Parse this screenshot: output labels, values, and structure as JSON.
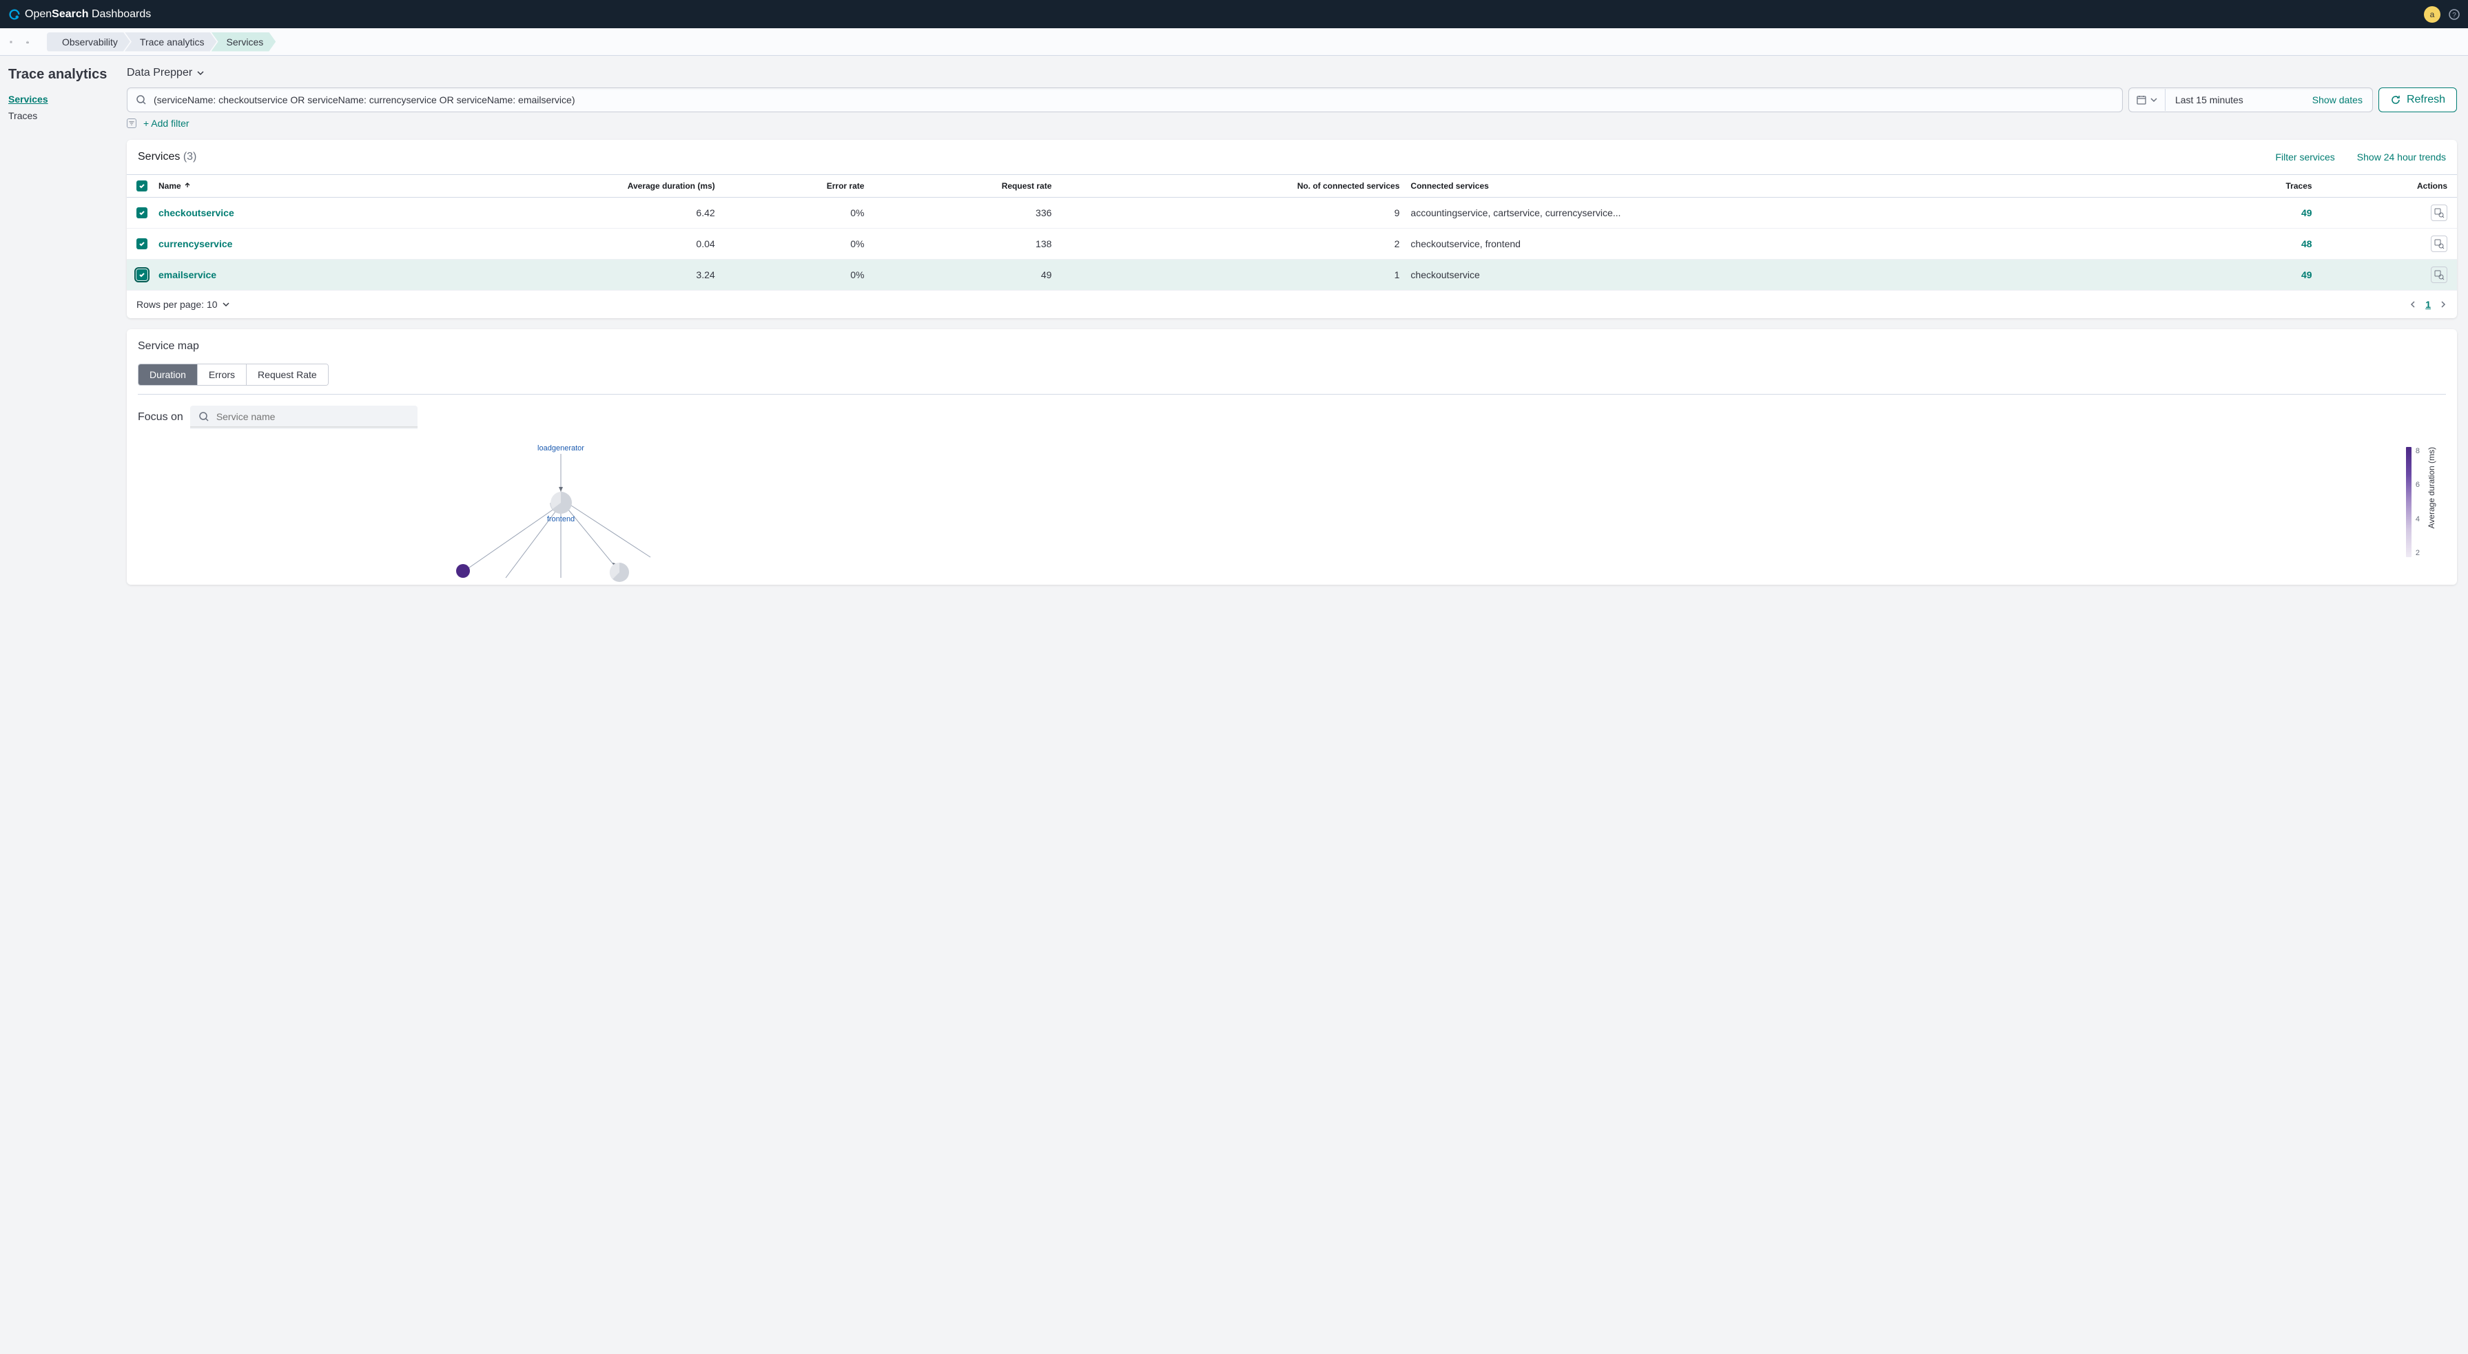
{
  "header": {
    "logo_prefix": "Open",
    "logo_mid": "Search",
    "logo_suffix": " Dashboards",
    "avatar_letter": "a"
  },
  "breadcrumbs": {
    "items": [
      {
        "label": "Observability"
      },
      {
        "label": "Trace analytics"
      },
      {
        "label": "Services"
      }
    ]
  },
  "sidebar": {
    "title": "Trace analytics",
    "items": [
      {
        "label": "Services"
      },
      {
        "label": "Traces"
      }
    ]
  },
  "toolbar": {
    "prepper_label": "Data Prepper",
    "search_value": "(serviceName: checkoutservice OR serviceName: currencyservice OR serviceName: emailservice)",
    "time_range": "Last 15 minutes",
    "show_dates": "Show dates",
    "refresh": "Refresh",
    "add_filter": "+ Add filter"
  },
  "services_panel": {
    "title": "Services",
    "count": "(3)",
    "filter_action": "Filter services",
    "trends_action": "Show 24 hour trends",
    "columns": {
      "name": "Name",
      "avg_duration": "Average duration (ms)",
      "error_rate": "Error rate",
      "request_rate": "Request rate",
      "connected_count": "No. of connected services",
      "connected": "Connected services",
      "traces": "Traces",
      "actions": "Actions"
    },
    "rows": [
      {
        "name": "checkoutservice",
        "avg": "6.42",
        "err": "0%",
        "req": "336",
        "conn_count": "9",
        "conn": "accountingservice, cartservice, currencyservice...",
        "traces": "49"
      },
      {
        "name": "currencyservice",
        "avg": "0.04",
        "err": "0%",
        "req": "138",
        "conn_count": "2",
        "conn": "checkoutservice, frontend",
        "traces": "48"
      },
      {
        "name": "emailservice",
        "avg": "3.24",
        "err": "0%",
        "req": "49",
        "conn_count": "1",
        "conn": "checkoutservice",
        "traces": "49"
      }
    ],
    "rows_per_page": "Rows per page: 10",
    "page": "1"
  },
  "service_map": {
    "title": "Service map",
    "tabs": [
      "Duration",
      "Errors",
      "Request Rate"
    ],
    "focus_label": "Focus on",
    "focus_placeholder": "Service name",
    "legend_label": "Average duration (ms)",
    "legend_ticks": [
      "8",
      "6",
      "4",
      "2"
    ],
    "nodes": {
      "loadgenerator": "loadgenerator",
      "frontend": "frontend"
    }
  },
  "chart_data": {
    "type": "table",
    "title": "Services",
    "columns": [
      "Name",
      "Average duration (ms)",
      "Error rate",
      "Request rate",
      "No. of connected services",
      "Traces"
    ],
    "rows": [
      [
        "checkoutservice",
        6.42,
        0,
        336,
        9,
        49
      ],
      [
        "currencyservice",
        0.04,
        0,
        138,
        2,
        48
      ],
      [
        "emailservice",
        3.24,
        0,
        49,
        1,
        49
      ]
    ],
    "legend_scale": {
      "min": 2,
      "max": 8,
      "label": "Average duration (ms)"
    }
  }
}
